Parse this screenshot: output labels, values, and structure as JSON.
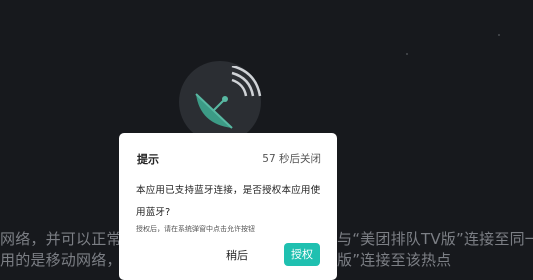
{
  "background": {
    "line1_left": "网络，并可以正常访",
    "line1_right": "与“美团排队TV版”连接至同一局",
    "line2_left": "用的是移动网络，可",
    "line2_right": "版”连接至该热点"
  },
  "dialog": {
    "title": "提示",
    "countdown": "57 秒后关闭",
    "message": "本应用已支持蓝牙连接，是否授权本应用使用蓝牙?",
    "hint": "授权后，请在系统弹窗中点击允许按钮",
    "later_label": "稍后",
    "authorize_label": "授权"
  },
  "colors": {
    "accent": "#1fc0b0",
    "background": "#17191d"
  },
  "icons": [
    "satellite-dish-icon"
  ]
}
